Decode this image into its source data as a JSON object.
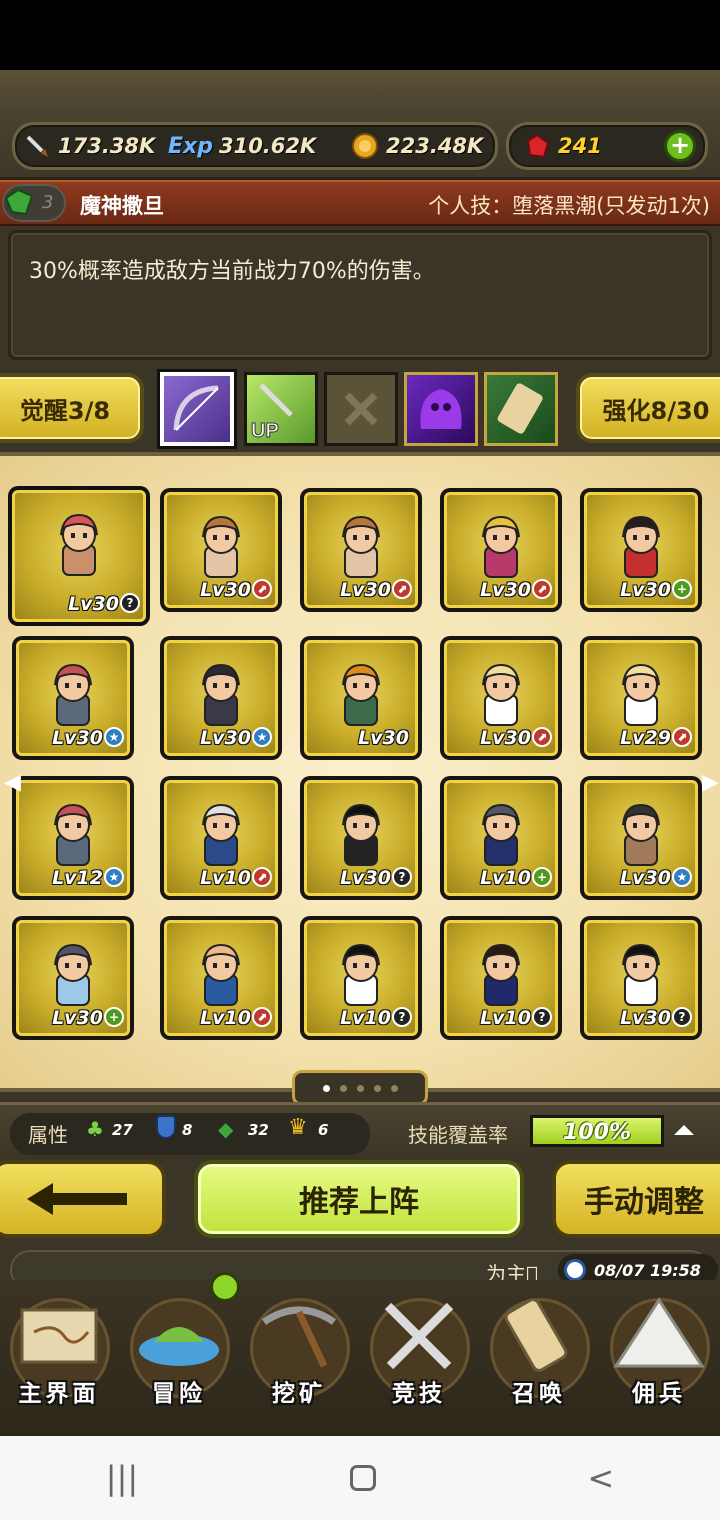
{
  "resources": {
    "attack": "173.38K",
    "exp": "310.62K",
    "gold": "223.48K",
    "ruby": "241"
  },
  "hero": {
    "gem_count": "3",
    "name": "魔神撒旦",
    "personal_skill": "个人技：堕落黑潮(只发动1次)",
    "description": "30%概率造成敌方当前战力70%的伤害。"
  },
  "awaken_button": "觉醒3/8",
  "enhance_button": "强化8/30",
  "roster": [
    {
      "lv": "Lv30",
      "badge": "?",
      "badge_color": "#222222",
      "hair": "#d9555a",
      "body": "#c9906b"
    },
    {
      "lv": "Lv30",
      "badge": "⬈",
      "badge_color": "#c0382b",
      "hair": "#b8753c",
      "body": "#e3c6a6"
    },
    {
      "lv": "Lv30",
      "badge": "⬈",
      "badge_color": "#c0382b",
      "hair": "#b8753c",
      "body": "#e3c6a6"
    },
    {
      "lv": "Lv30",
      "badge": "⬈",
      "badge_color": "#c0382b",
      "hair": "#e8c03c",
      "body": "#b83a6a"
    },
    {
      "lv": "Lv30",
      "badge": "+",
      "badge_color": "#4e9a1e",
      "hair": "#2a1a1a",
      "body": "#c43030"
    },
    {
      "lv": "Lv30",
      "badge": "★",
      "badge_color": "#2f7fc0",
      "hair": "#c7505a",
      "body": "#5a6a7a"
    },
    {
      "lv": "Lv30",
      "badge": "★",
      "badge_color": "#2f7fc0",
      "hair": "#2a2a32",
      "body": "#3a3a46"
    },
    {
      "lv": "Lv30",
      "badge": "",
      "badge_color": "",
      "hair": "#e08a1a",
      "body": "#3c6a4a"
    },
    {
      "lv": "Lv30",
      "badge": "⬈",
      "badge_color": "#c0382b",
      "hair": "#f0e0a0",
      "body": "#ffffff"
    },
    {
      "lv": "Lv29",
      "badge": "⬈",
      "badge_color": "#c0382b",
      "hair": "#f0e0a0",
      "body": "#ffffff"
    },
    {
      "lv": "Lv12",
      "badge": "★",
      "badge_color": "#2f7fc0",
      "hair": "#c7505a",
      "body": "#5a6a7a"
    },
    {
      "lv": "Lv10",
      "badge": "⬈",
      "badge_color": "#c0382b",
      "hair": "#e0e0e0",
      "body": "#2a4a8a"
    },
    {
      "lv": "Lv30",
      "badge": "?",
      "badge_color": "#222222",
      "hair": "#111111",
      "body": "#222222"
    },
    {
      "lv": "Lv10",
      "badge": "+",
      "badge_color": "#4e9a1e",
      "hair": "#555566",
      "body": "#23306a"
    },
    {
      "lv": "Lv30",
      "badge": "★",
      "badge_color": "#2f7fc0",
      "hair": "#333333",
      "body": "#a07a5a"
    },
    {
      "lv": "Lv30",
      "badge": "+",
      "badge_color": "#4e9a1e",
      "hair": "#555566",
      "body": "#9ec8e8"
    },
    {
      "lv": "Lv10",
      "badge": "⬈",
      "badge_color": "#c0382b",
      "hair": "#f0b88a",
      "body": "#2a5aa0"
    },
    {
      "lv": "Lv10",
      "badge": "?",
      "badge_color": "#222222",
      "hair": "#111111",
      "body": "#ffffff"
    },
    {
      "lv": "Lv10",
      "badge": "?",
      "badge_color": "#222222",
      "hair": "#2a1a10",
      "body": "#1e2a6a"
    },
    {
      "lv": "Lv30",
      "badge": "?",
      "badge_color": "#222222",
      "hair": "#111111",
      "body": "#ffffff"
    }
  ],
  "attributes": {
    "label": "属性",
    "stats": [
      "27",
      "8",
      "32",
      "6"
    ],
    "coverage_label": "技能覆盖率",
    "coverage_value": "100%"
  },
  "actions": {
    "recommend": "推荐上阵",
    "manual": "手动调整"
  },
  "ticker": {
    "message": "为主\u0000",
    "datetime": "08/07 19:58"
  },
  "nav": [
    "主界面",
    "冒险",
    "挖矿",
    "竞技",
    "召唤",
    "佣兵"
  ],
  "colors": {
    "accent_yellow": "#f1d34a",
    "accent_green": "#c0e23a",
    "banner_red": "#8e3a1e"
  }
}
